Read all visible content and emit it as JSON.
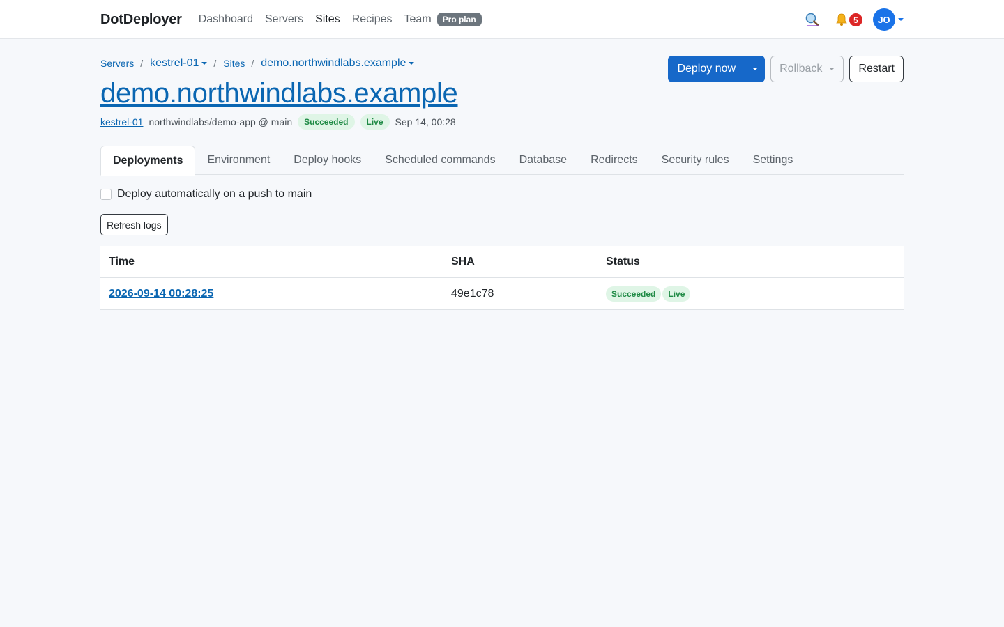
{
  "nav": {
    "brand": "DotDeployer",
    "links": [
      {
        "label": "Dashboard",
        "active": false
      },
      {
        "label": "Servers",
        "active": false
      },
      {
        "label": "Sites",
        "active": true
      },
      {
        "label": "Recipes",
        "active": false
      },
      {
        "label": "Team",
        "active": false
      }
    ],
    "plan_badge": "Pro plan",
    "notifications_count": "5",
    "avatar_initials": "JO",
    "icons": [
      "search-icon",
      "bell-icon"
    ]
  },
  "breadcrumb": {
    "servers": "Servers",
    "server": "kestrel-01",
    "sites": "Sites",
    "site": "demo.northwindlabs.example"
  },
  "site": {
    "title": "demo.northwindlabs.example",
    "server_link": "kestrel-01",
    "repo": "northwindlabs/demo-app @ main",
    "status": "Succeeded",
    "live": "Live",
    "timestamp": "Sep 14, 00:28"
  },
  "actions": {
    "deploy": "Deploy now",
    "rollback": "Rollback",
    "restart": "Restart"
  },
  "tabs": [
    {
      "label": "Deployments",
      "active": true
    },
    {
      "label": "Environment",
      "active": false
    },
    {
      "label": "Deploy hooks",
      "active": false
    },
    {
      "label": "Scheduled commands",
      "active": false
    },
    {
      "label": "Database",
      "active": false
    },
    {
      "label": "Redirects",
      "active": false
    },
    {
      "label": "Security rules",
      "active": false
    },
    {
      "label": "Settings",
      "active": false
    }
  ],
  "deployments": {
    "auto_deploy_label": "Deploy automatically on a push to main",
    "auto_deploy_checked": false,
    "refresh_label": "Refresh logs",
    "columns": [
      "Time",
      "SHA",
      "Status"
    ],
    "rows": [
      {
        "time": "2026-09-14 00:28:25",
        "sha": "49e1c78",
        "status": "Succeeded",
        "live": "Live"
      }
    ]
  },
  "colors": {
    "primary": "#1668c9",
    "link": "#0a66b2",
    "success_text": "#1f8a45",
    "success_bg": "#dff5e6",
    "danger": "#dc2626",
    "background": "#f6f8fb"
  }
}
